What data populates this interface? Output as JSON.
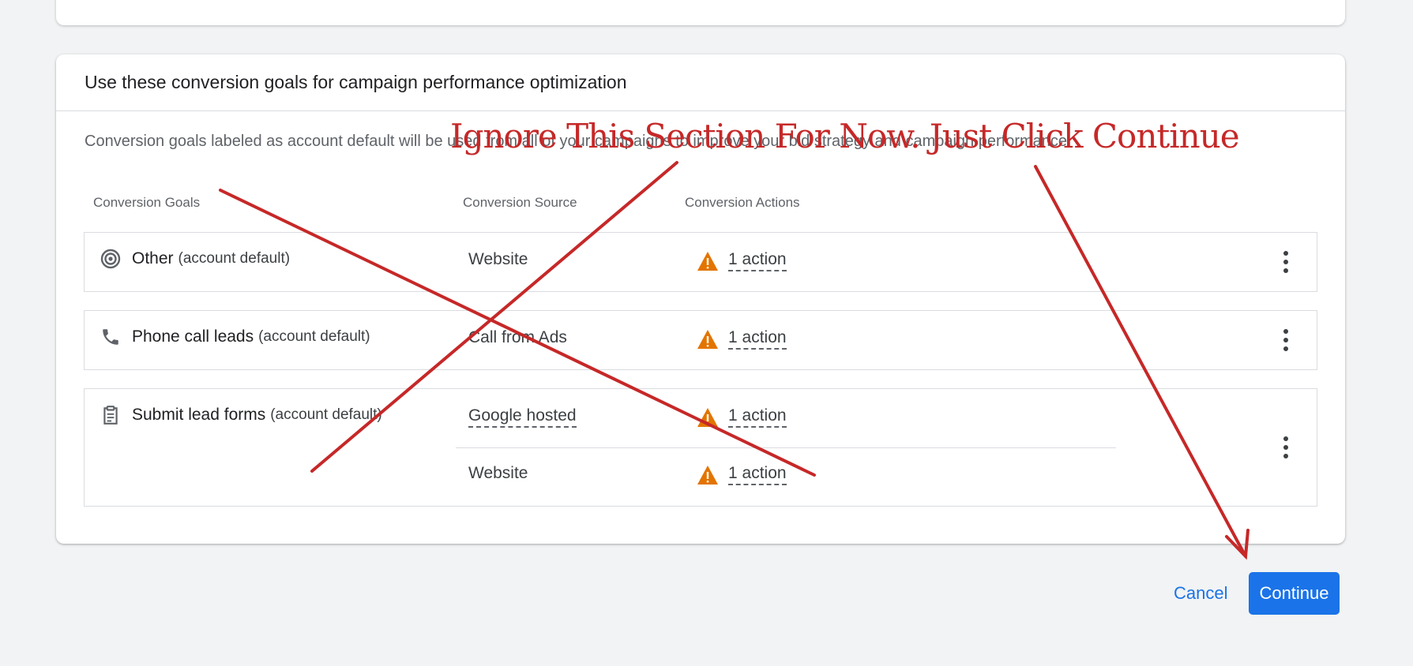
{
  "section": {
    "title": "Use these conversion goals for campaign performance optimization",
    "description": "Conversion goals labeled as account default will be used from all of your campaigns to improve your bid strategy and campaign performance"
  },
  "columns": {
    "goals": "Conversion Goals",
    "source": "Conversion Source",
    "actions": "Conversion Actions"
  },
  "rows": [
    {
      "icon": "target-icon",
      "name": "Other",
      "suffix": "(account default)",
      "entries": [
        {
          "source": "Website",
          "action": "1 action"
        }
      ]
    },
    {
      "icon": "phone-icon",
      "name": "Phone call leads",
      "suffix": "(account default)",
      "entries": [
        {
          "source": "Call from Ads",
          "action": "1 action"
        }
      ]
    },
    {
      "icon": "clipboard-icon",
      "name": "Submit lead forms",
      "suffix": "(account default)",
      "entries": [
        {
          "source": "Google hosted",
          "action": "1 action"
        },
        {
          "source": "Website",
          "action": "1 action"
        }
      ]
    }
  ],
  "footer": {
    "cancel_label": "Cancel",
    "continue_label": "Continue"
  },
  "annotation": {
    "text": "Ignore This Section For Now.  Just Click Continue",
    "color": "#c62828"
  },
  "colors": {
    "primary": "#1a73e8",
    "warning": "#e37400"
  }
}
